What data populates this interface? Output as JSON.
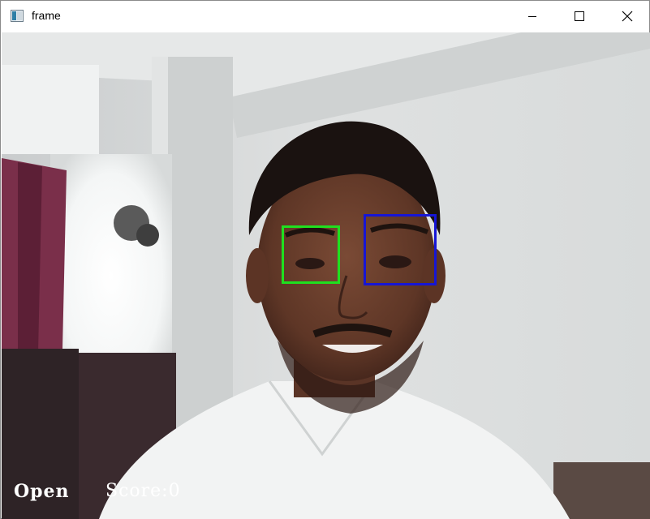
{
  "window": {
    "title": "frame",
    "icon": "app-window-icon",
    "controls": [
      "minimize-icon",
      "maximize-icon",
      "close-icon"
    ]
  },
  "overlay": {
    "status_label": "Open",
    "score_label": "Score:0"
  },
  "detections": {
    "left_eye_color": "#1fe01f",
    "right_eye_color": "#1616d6"
  }
}
